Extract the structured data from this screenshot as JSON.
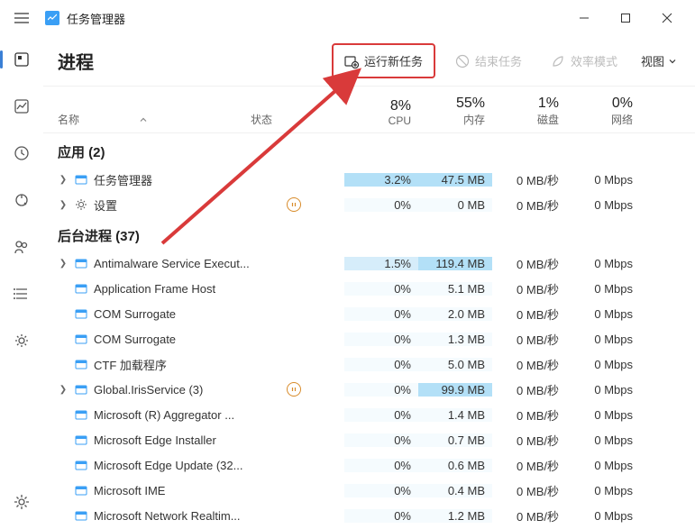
{
  "titlebar": {
    "title": "任务管理器"
  },
  "toolbar": {
    "page_title": "进程",
    "run_new_task": "运行新任务",
    "end_task": "结束任务",
    "efficiency_mode": "效率模式",
    "view": "视图"
  },
  "columns": {
    "name": "名称",
    "status": "状态",
    "cpu_pct": "8%",
    "cpu_lbl": "CPU",
    "mem_pct": "55%",
    "mem_lbl": "内存",
    "disk_pct": "1%",
    "disk_lbl": "磁盘",
    "net_pct": "0%",
    "net_lbl": "网络"
  },
  "groups": {
    "apps": {
      "label": "应用 (2)"
    },
    "bg": {
      "label": "后台进程 (37)"
    }
  },
  "rows": [
    {
      "name": "任务管理器",
      "expand": true,
      "status": "",
      "cpu": "3.2%",
      "mem": "47.5 MB",
      "disk": "0 MB/秒",
      "net": "0 Mbps",
      "cpu_hl": "hl1",
      "mem_hl": "hl1"
    },
    {
      "name": "设置",
      "expand": true,
      "status": "pause",
      "cpu": "0%",
      "mem": "0 MB",
      "disk": "0 MB/秒",
      "net": "0 Mbps",
      "cpu_hl": "hl0",
      "mem_hl": "hl0"
    },
    {
      "name": "Antimalware Service Execut...",
      "expand": true,
      "status": "",
      "cpu": "1.5%",
      "mem": "119.4 MB",
      "disk": "0 MB/秒",
      "net": "0 Mbps",
      "cpu_hl": "hl2",
      "mem_hl": "hl1"
    },
    {
      "name": "Application Frame Host",
      "expand": false,
      "status": "",
      "cpu": "0%",
      "mem": "5.1 MB",
      "disk": "0 MB/秒",
      "net": "0 Mbps",
      "cpu_hl": "hl0",
      "mem_hl": "hl0"
    },
    {
      "name": "COM Surrogate",
      "expand": false,
      "status": "",
      "cpu": "0%",
      "mem": "2.0 MB",
      "disk": "0 MB/秒",
      "net": "0 Mbps",
      "cpu_hl": "hl0",
      "mem_hl": "hl0"
    },
    {
      "name": "COM Surrogate",
      "expand": false,
      "status": "",
      "cpu": "0%",
      "mem": "1.3 MB",
      "disk": "0 MB/秒",
      "net": "0 Mbps",
      "cpu_hl": "hl0",
      "mem_hl": "hl0"
    },
    {
      "name": "CTF 加载程序",
      "expand": false,
      "status": "",
      "cpu": "0%",
      "mem": "5.0 MB",
      "disk": "0 MB/秒",
      "net": "0 Mbps",
      "cpu_hl": "hl0",
      "mem_hl": "hl0"
    },
    {
      "name": "Global.IrisService (3)",
      "expand": true,
      "status": "pause",
      "cpu": "0%",
      "mem": "99.9 MB",
      "disk": "0 MB/秒",
      "net": "0 Mbps",
      "cpu_hl": "hl0",
      "mem_hl": "hl1"
    },
    {
      "name": "Microsoft (R) Aggregator ...",
      "expand": false,
      "status": "",
      "cpu": "0%",
      "mem": "1.4 MB",
      "disk": "0 MB/秒",
      "net": "0 Mbps",
      "cpu_hl": "hl0",
      "mem_hl": "hl0"
    },
    {
      "name": "Microsoft Edge Installer",
      "expand": false,
      "status": "",
      "cpu": "0%",
      "mem": "0.7 MB",
      "disk": "0 MB/秒",
      "net": "0 Mbps",
      "cpu_hl": "hl0",
      "mem_hl": "hl0"
    },
    {
      "name": "Microsoft Edge Update (32...",
      "expand": false,
      "status": "",
      "cpu": "0%",
      "mem": "0.6 MB",
      "disk": "0 MB/秒",
      "net": "0 Mbps",
      "cpu_hl": "hl0",
      "mem_hl": "hl0"
    },
    {
      "name": "Microsoft IME",
      "expand": false,
      "status": "",
      "cpu": "0%",
      "mem": "0.4 MB",
      "disk": "0 MB/秒",
      "net": "0 Mbps",
      "cpu_hl": "hl0",
      "mem_hl": "hl0"
    },
    {
      "name": "Microsoft Network Realtim...",
      "expand": false,
      "status": "",
      "cpu": "0%",
      "mem": "1.2 MB",
      "disk": "0 MB/秒",
      "net": "0 Mbps",
      "cpu_hl": "hl0",
      "mem_hl": "hl0"
    }
  ]
}
